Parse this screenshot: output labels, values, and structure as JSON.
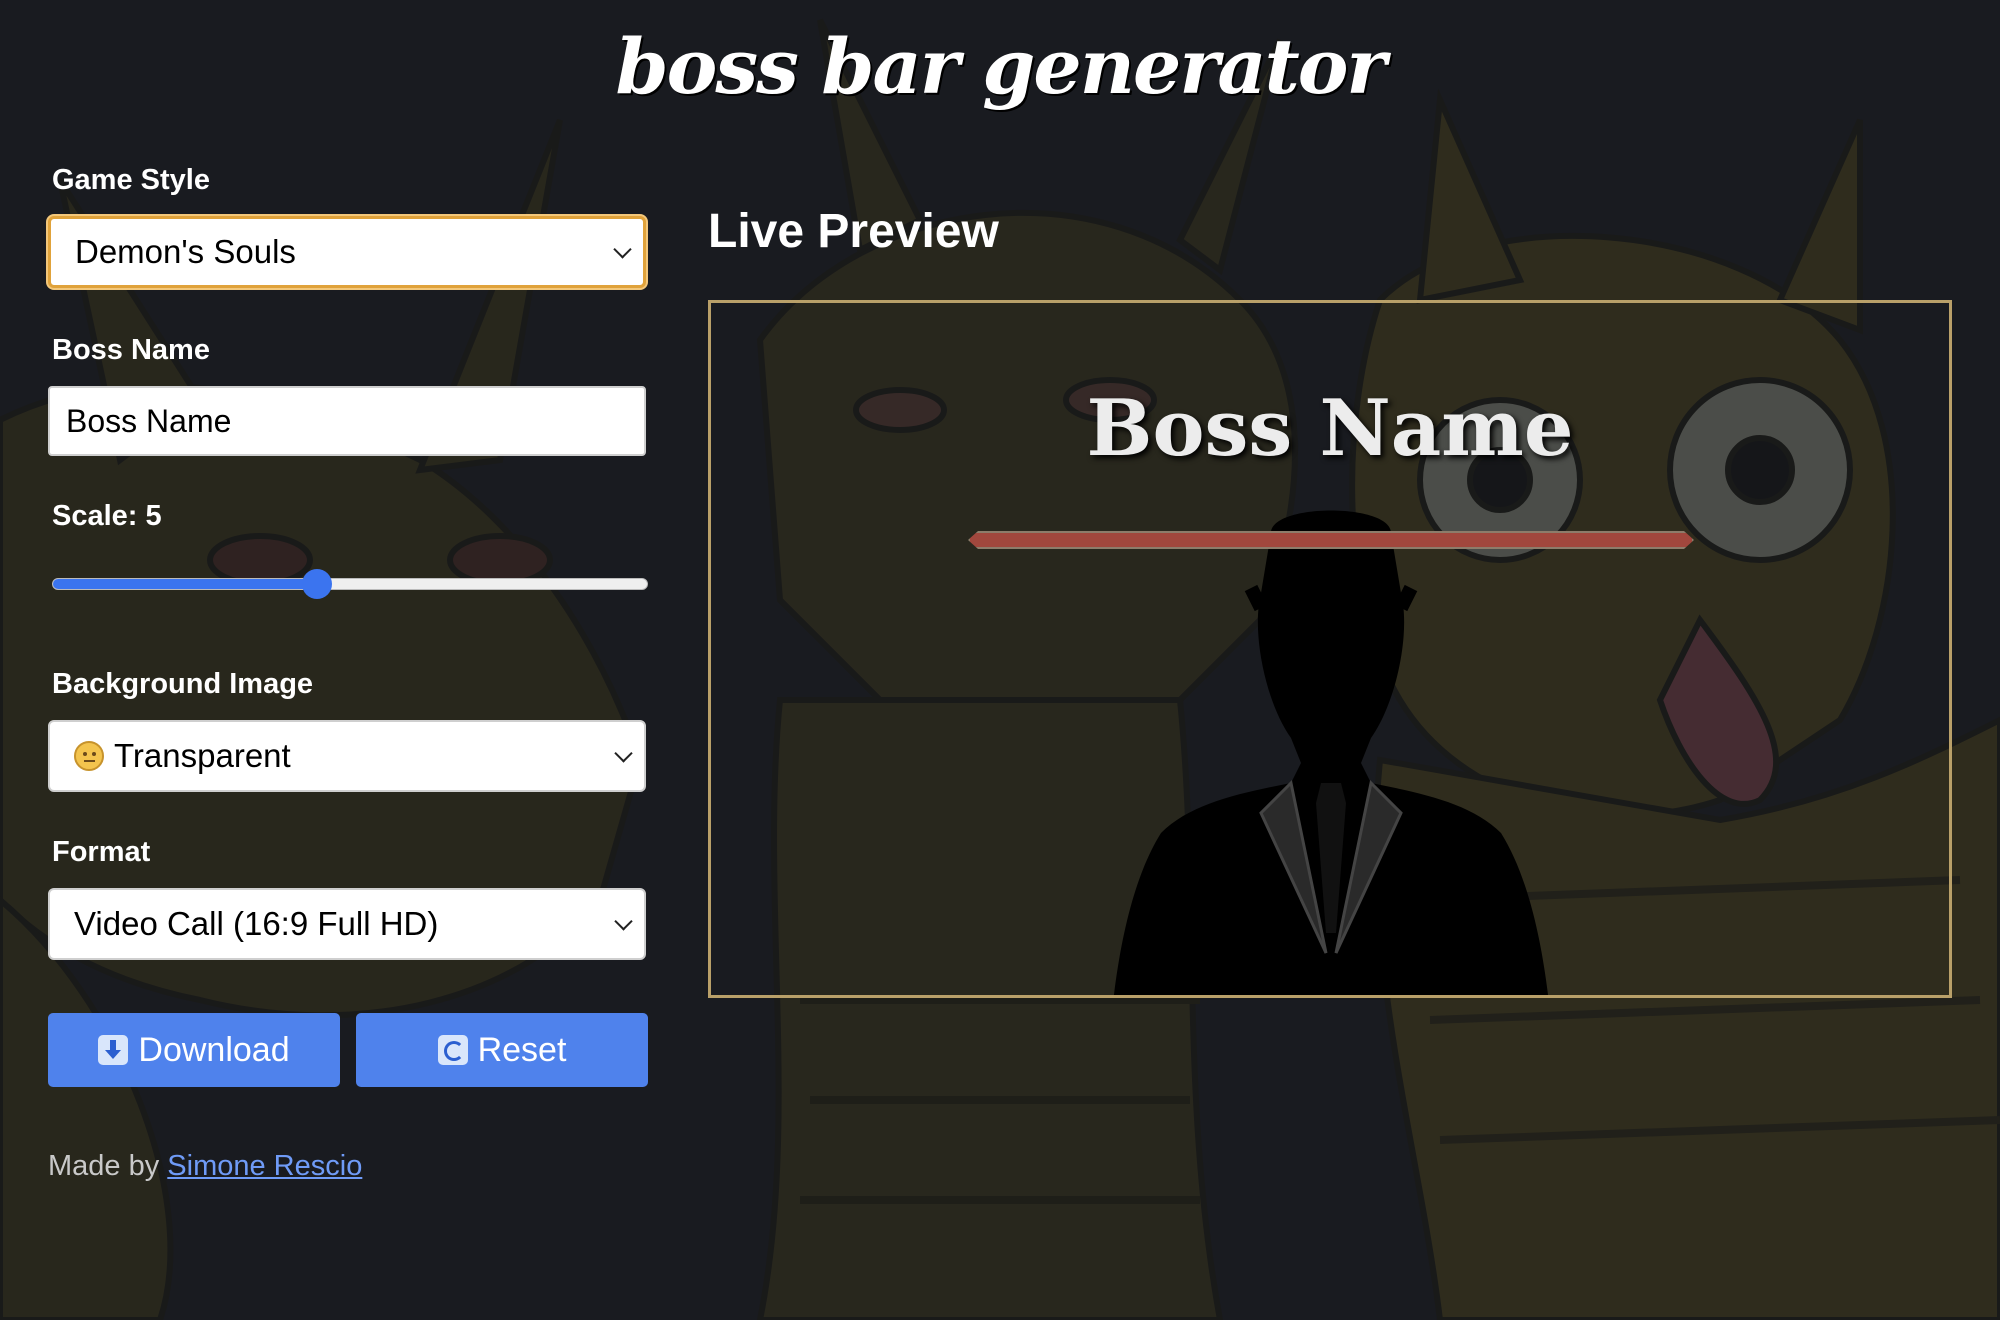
{
  "app": {
    "title": "boss bar generator"
  },
  "controls": {
    "game_style": {
      "label": "Game Style",
      "value": "Demon's Souls"
    },
    "boss_name": {
      "label": "Boss Name",
      "value": "Boss Name"
    },
    "scale": {
      "label": "Scale: 5",
      "value": 5,
      "min": 1,
      "max": 10
    },
    "background_image": {
      "label": "Background Image",
      "value": "Transparent",
      "icon": "neutral-face-emoji-icon"
    },
    "format": {
      "label": "Format",
      "value": "Video Call (16:9 Full HD)"
    },
    "buttons": {
      "download": {
        "label": "Download",
        "icon": "down-arrow-icon"
      },
      "reset": {
        "label": "Reset",
        "icon": "reset-icon"
      }
    }
  },
  "footer": {
    "prefix": "Made by ",
    "link_text": "Simone Rescio"
  },
  "preview": {
    "heading": "Live Preview",
    "boss_name": "Boss Name",
    "health_fill": 1.0
  },
  "colors": {
    "accent": "#4f82ec",
    "frame_border": "#b9a069",
    "health": "#a1473d",
    "focus_ring": "#e0a23a"
  }
}
